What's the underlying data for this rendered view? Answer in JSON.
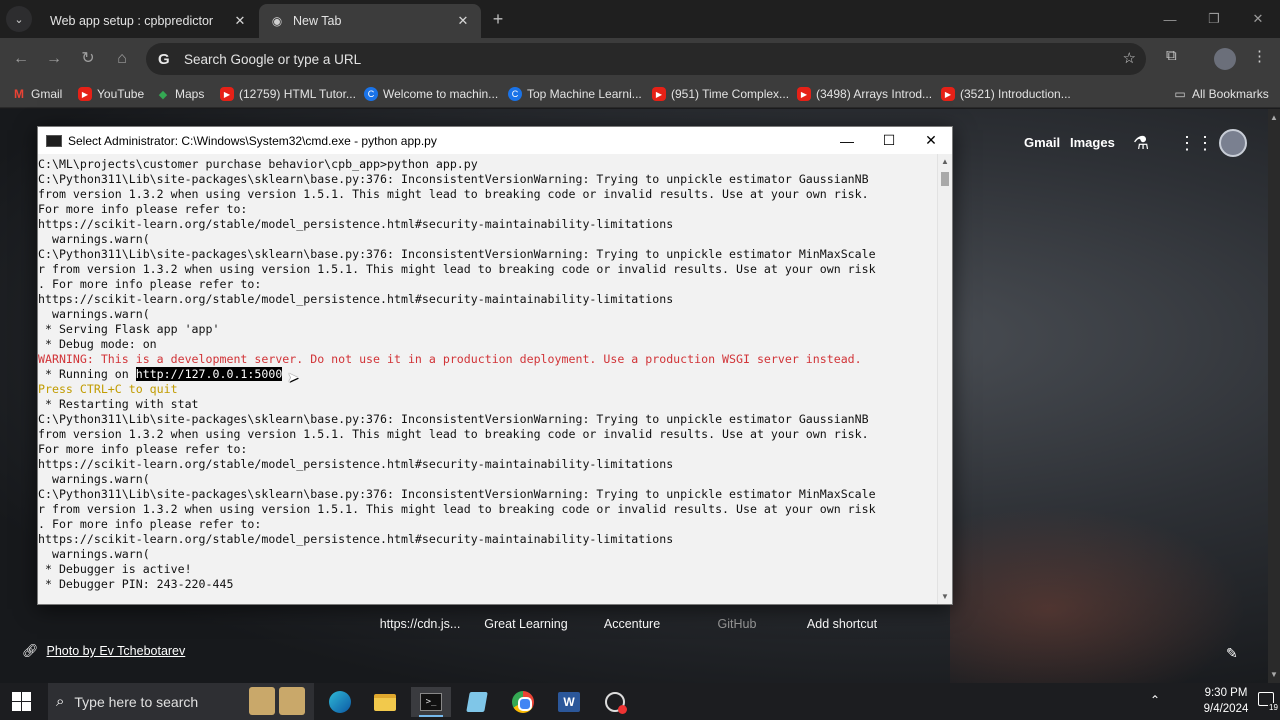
{
  "browser": {
    "tabs": [
      {
        "title": "Web app setup : cpbpredictor",
        "active": false,
        "close": "✕"
      },
      {
        "title": "New Tab",
        "active": true,
        "close": "✕"
      }
    ],
    "new_tab_symbol": "+",
    "omnibox": {
      "placeholder": "Search Google or type a URL"
    },
    "bookmarks": [
      {
        "label": "Gmail",
        "icon": "gmail-icon"
      },
      {
        "label": "YouTube",
        "icon": "youtube-icon"
      },
      {
        "label": "Maps",
        "icon": "maps-icon"
      },
      {
        "label": "(12759) HTML Tutor...",
        "icon": "youtube-icon"
      },
      {
        "label": "Welcome to machin...",
        "icon": "site-icon"
      },
      {
        "label": "Top Machine Learni...",
        "icon": "site-icon"
      },
      {
        "label": "(951) Time Complex...",
        "icon": "youtube-icon"
      },
      {
        "label": "(3498) Arrays Introd...",
        "icon": "youtube-icon"
      },
      {
        "label": "(3521) Introduction...",
        "icon": "youtube-icon"
      }
    ],
    "all_bookmarks": "All Bookmarks"
  },
  "ntp": {
    "gmail": "Gmail",
    "images": "Images",
    "shortcuts": [
      "https://cdn.js...",
      "Great Learning",
      "Accenture",
      "GitHub",
      "Add shortcut"
    ],
    "photo_credit": "Photo by Ev Tchebotarev"
  },
  "cmd": {
    "title": "Select Administrator: C:\\Windows\\System32\\cmd.exe - python  app.py",
    "lines": [
      {
        "text": "C:\\ML\\projects\\customer purchase behavior\\cpb_app>python app.py",
        "style": "normal"
      },
      {
        "text": "C:\\Python311\\Lib\\site-packages\\sklearn\\base.py:376: InconsistentVersionWarning: Trying to unpickle estimator GaussianNB",
        "style": "normal"
      },
      {
        "text": "from version 1.3.2 when using version 1.5.1. This might lead to breaking code or invalid results. Use at your own risk.",
        "style": "normal"
      },
      {
        "text": "For more info please refer to:",
        "style": "normal"
      },
      {
        "text": "https://scikit-learn.org/stable/model_persistence.html#security-maintainability-limitations",
        "style": "normal"
      },
      {
        "text": "  warnings.warn(",
        "style": "normal"
      },
      {
        "text": "C:\\Python311\\Lib\\site-packages\\sklearn\\base.py:376: InconsistentVersionWarning: Trying to unpickle estimator MinMaxScale",
        "style": "normal"
      },
      {
        "text": "r from version 1.3.2 when using version 1.5.1. This might lead to breaking code or invalid results. Use at your own risk",
        "style": "normal"
      },
      {
        "text": ". For more info please refer to:",
        "style": "normal"
      },
      {
        "text": "https://scikit-learn.org/stable/model_persistence.html#security-maintainability-limitations",
        "style": "normal"
      },
      {
        "text": "  warnings.warn(",
        "style": "normal"
      },
      {
        "text": " * Serving Flask app 'app'",
        "style": "normal"
      },
      {
        "text": " * Debug mode: on",
        "style": "normal"
      },
      {
        "text": "WARNING: This is a development server. Do not use it in a production deployment. Use a production WSGI server instead.",
        "style": "warn"
      },
      {
        "text": " * Running on ",
        "style": "running",
        "selected": "http://127.0.0.1:5000"
      },
      {
        "text": "Press CTRL+C to quit",
        "style": "hint"
      },
      {
        "text": " * Restarting with stat",
        "style": "normal"
      },
      {
        "text": "C:\\Python311\\Lib\\site-packages\\sklearn\\base.py:376: InconsistentVersionWarning: Trying to unpickle estimator GaussianNB",
        "style": "normal"
      },
      {
        "text": "from version 1.3.2 when using version 1.5.1. This might lead to breaking code or invalid results. Use at your own risk.",
        "style": "normal"
      },
      {
        "text": "For more info please refer to:",
        "style": "normal"
      },
      {
        "text": "https://scikit-learn.org/stable/model_persistence.html#security-maintainability-limitations",
        "style": "normal"
      },
      {
        "text": "  warnings.warn(",
        "style": "normal"
      },
      {
        "text": "C:\\Python311\\Lib\\site-packages\\sklearn\\base.py:376: InconsistentVersionWarning: Trying to unpickle estimator MinMaxScale",
        "style": "normal"
      },
      {
        "text": "r from version 1.3.2 when using version 1.5.1. This might lead to breaking code or invalid results. Use at your own risk",
        "style": "normal"
      },
      {
        "text": ". For more info please refer to:",
        "style": "normal"
      },
      {
        "text": "https://scikit-learn.org/stable/model_persistence.html#security-maintainability-limitations",
        "style": "normal"
      },
      {
        "text": "  warnings.warn(",
        "style": "normal"
      },
      {
        "text": " * Debugger is active!",
        "style": "normal"
      },
      {
        "text": " * Debugger PIN: 243-220-445",
        "style": "normal"
      }
    ]
  },
  "taskbar": {
    "search_placeholder": "Type here to search",
    "time": "9:30 PM",
    "date": "9/4/2024",
    "notification_count": "19"
  },
  "colors": {
    "cmd_warning": "#d13438",
    "cmd_hint": "#c19c00",
    "accent": "#76b9ed"
  }
}
